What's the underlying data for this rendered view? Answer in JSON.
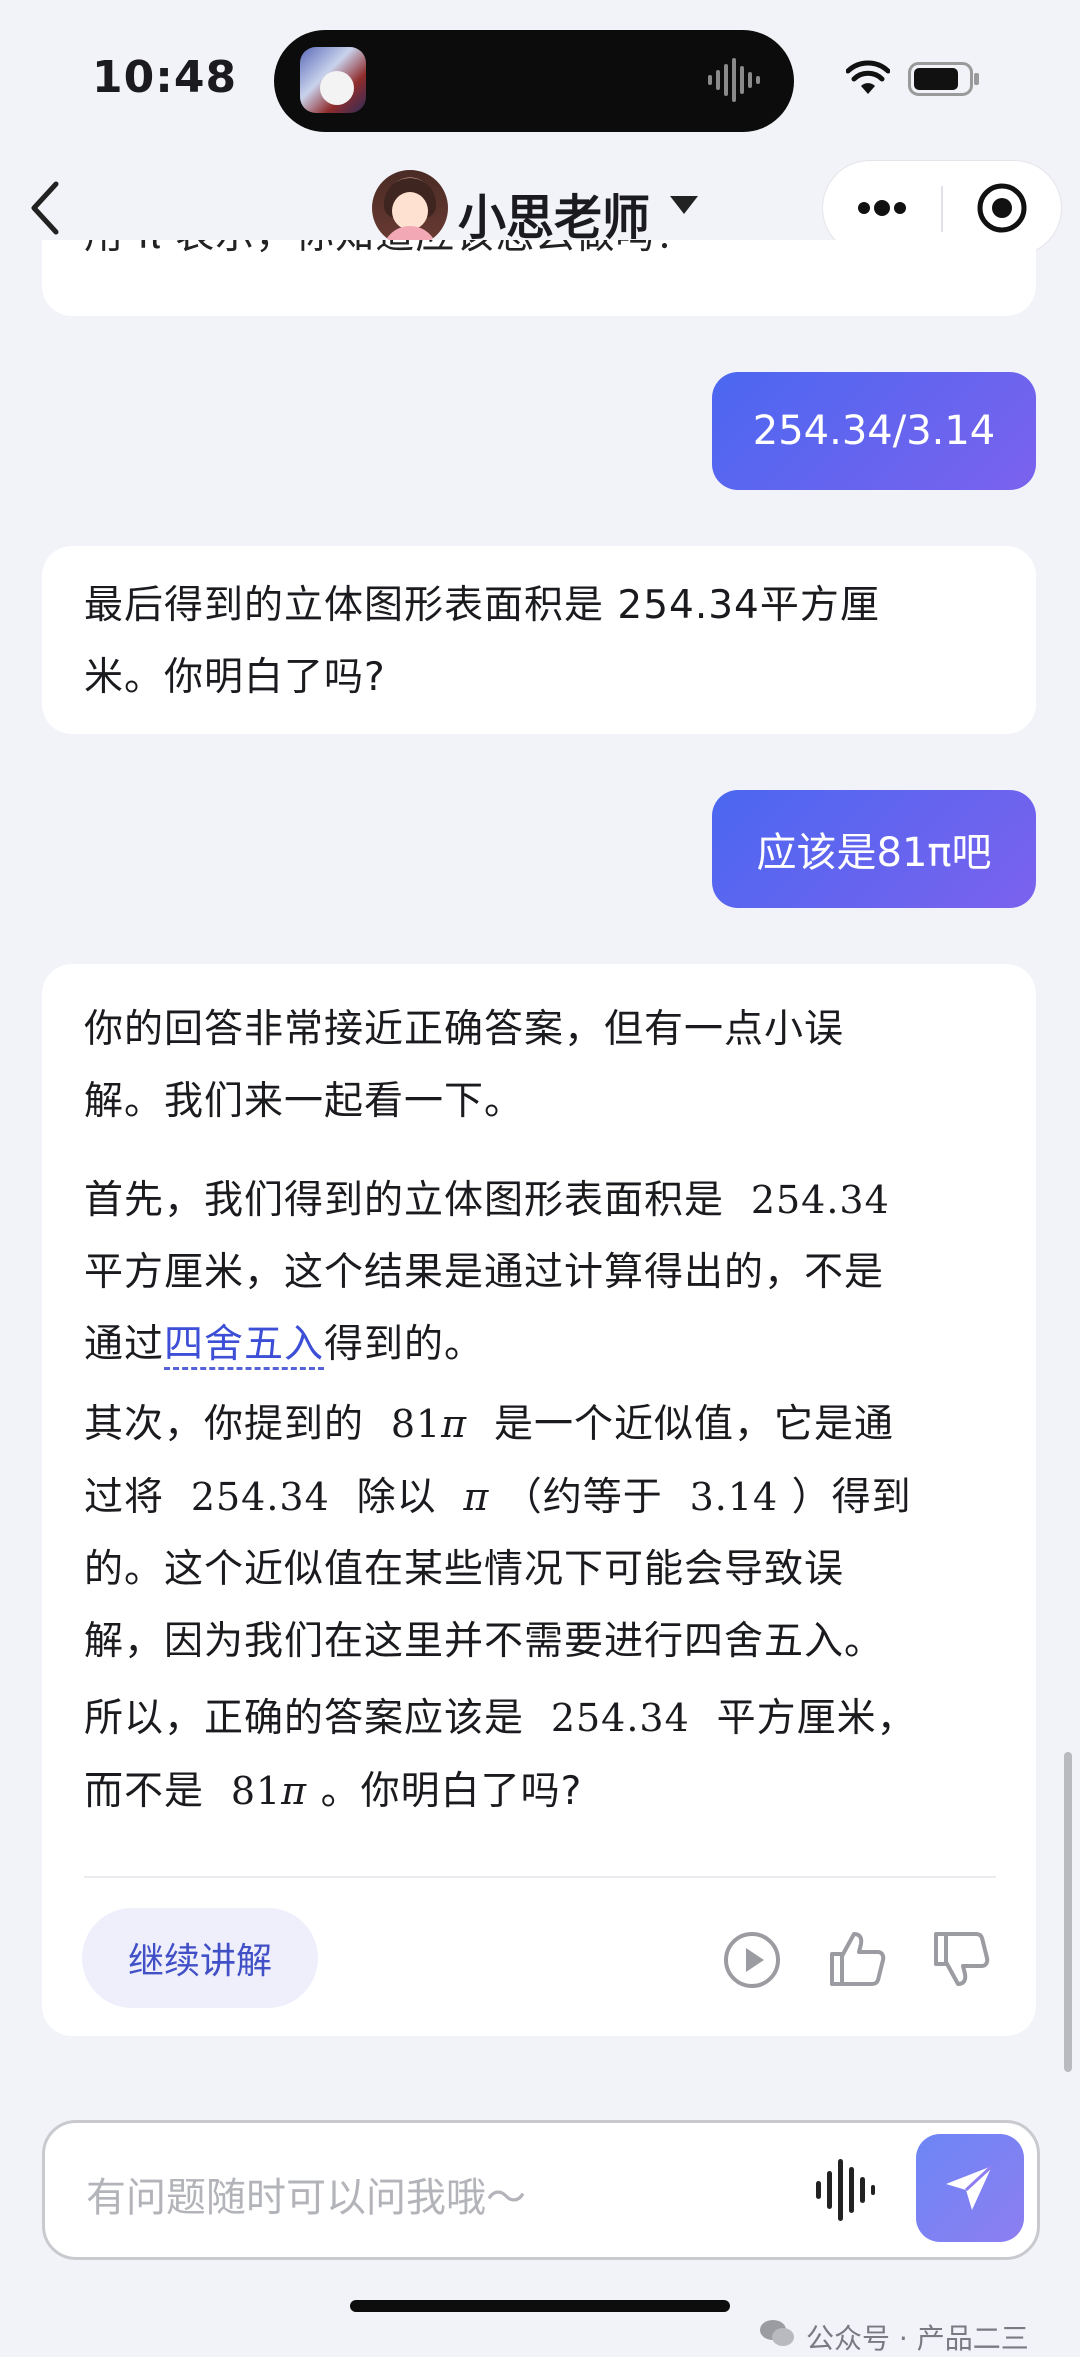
{
  "status_bar": {
    "time": "10:48"
  },
  "nav": {
    "title": "小思老师"
  },
  "chat": {
    "top_partial_text": "用 π 表示，你知道应该怎么做吗？",
    "user_msg_1": "254.34/3.14",
    "ai_msg_2_line1": "最后得到的立体图形表面积是 254.34平方厘",
    "ai_msg_2_line2": "米。你明白了吗?",
    "user_msg_2": "应该是81π吧",
    "ai_msg_3": {
      "p1_l1": "你的回答非常接近正确答案，但有一点小误",
      "p1_l2": "解。我们来一起看一下。",
      "p2_l1_a": "首先，我们得到的立体图形表面积是",
      "p2_l1_math": "254.34",
      "p2_l2": "平方厘米，这个结果是通过计算得出的，不是",
      "p2_l3_a": "通过",
      "p2_l3_link": "四舍五入",
      "p2_l3_b": "得到的。",
      "p3_l1_a": "其次，你提到的",
      "p3_l1_math": "81",
      "p3_pi": "π",
      "p3_l1_b": "是一个近似值，它是通",
      "p3_l2_a": "过将",
      "p3_l2_math1": "254.34",
      "p3_l2_b": "除以",
      "p3_l2_c": "（约等于",
      "p3_l2_math2": "3.14",
      "p3_l2_d": "）得到",
      "p3_l3": "的。这个近似值在某些情况下可能会导致误",
      "p3_l4": "解，因为我们在这里并不需要进行四舍五入。",
      "p4_l1_a": "所以，正确的答案应该是",
      "p4_l1_math": "254.34",
      "p4_l1_b": "平方厘米，",
      "p4_l2_a": "而不是",
      "p4_l2_math": "81",
      "p4_l2_b": "。你明白了吗?"
    },
    "continue_label": "继续讲解"
  },
  "input": {
    "placeholder": "有问题随时可以问我哦～"
  },
  "footer": {
    "watermark": "公众号 · 产品二三"
  },
  "icons": [
    "back-icon",
    "chevron-down-icon",
    "more-icon",
    "close-icon",
    "play-icon",
    "like-icon",
    "dislike-icon",
    "voice-icon",
    "send-icon",
    "wifi-icon",
    "battery-icon"
  ],
  "colors": {
    "user_bubble_start": "#4b67f0",
    "user_bubble_end": "#7b62ee",
    "link": "#3d4fd6",
    "background": "#f2f3f8"
  }
}
